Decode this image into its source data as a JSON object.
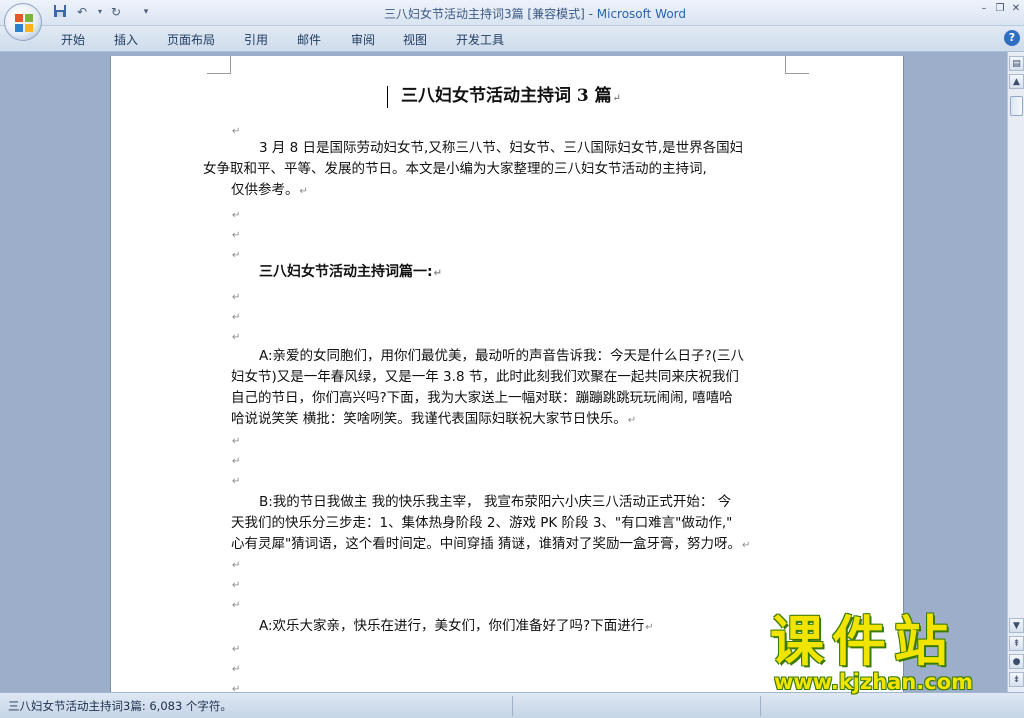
{
  "window": {
    "title_doc": "三八妇女节活动主持词3篇 [兼容模式]",
    "title_sep": " - ",
    "title_app": "Microsoft Word"
  },
  "quick_access": {
    "save_icon": "save-icon",
    "undo_icon": "undo-icon",
    "redo_icon": "redo-icon",
    "customize_icon": "customize-icon"
  },
  "ribbon": {
    "tabs": [
      "开始",
      "插入",
      "页面布局",
      "引用",
      "邮件",
      "审阅",
      "视图",
      "开发工具"
    ]
  },
  "document": {
    "title": "三八妇女节活动主持词 3 篇",
    "intro_1": "3 月 8 日是国际劳动妇女节,又称三八节、妇女节、三八国际妇女节,是世界各国妇",
    "intro_2": "女争取和平、平等、发展的节日。本文是小编为大家整理的三八妇女节活动的主持词,",
    "intro_3": "仅供参考。",
    "heading_1": "三八妇女节活动主持词篇一:",
    "a1_1": "A:亲爱的女同胞们，用你们最优美，最动听的声音告诉我：今天是什么日子?(三八",
    "a1_2": "妇女节)又是一年春风绿，又是一年 3.8 节，此时此刻我们欢聚在一起共同来庆祝我们",
    "a1_3": "自己的节日，你们高兴吗?下面，我为大家送上一幅对联：蹦蹦跳跳玩玩闹闹, 嘻嘻哈",
    "a1_4": "哈说说笑笑 横批：笑啥咧笑。我谨代表国际妇联祝大家节日快乐。",
    "b1_1": "B:我的节日我做主 我的快乐我主宰， 我宣布荥阳六小庆三八活动正式开始： 今",
    "b1_2": "天我们的快乐分三步走：1、集体热身阶段 2、游戏 PK 阶段 3、\"有口难言\"做动作,\"",
    "b1_3": "心有灵犀\"猜词语，这个看时间定。中间穿插 猜谜，谁猜对了奖励一盒牙膏，努力呀。",
    "a2_1": "A:欢乐大家亲，快乐在进行，美女们，你们准备好了吗?下面进行"
  },
  "status": {
    "text": "三八妇女节活动主持词3篇: 6,083 个字符。"
  },
  "watermark": {
    "main": "课件站",
    "url": "www.kjzhan.com"
  },
  "colors": {
    "ribbon_bg": "#d9e4f2",
    "doc_bg": "#9caec9",
    "watermark": "#f0e400"
  }
}
